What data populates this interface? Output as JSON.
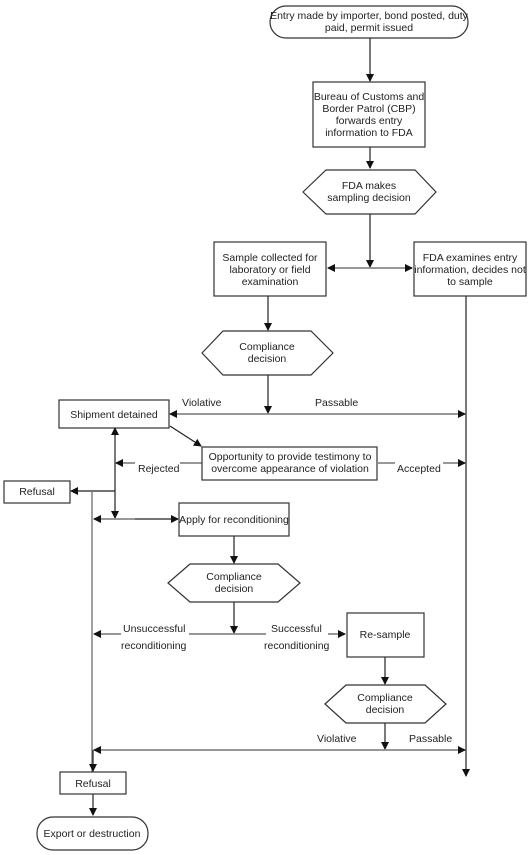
{
  "diagram": {
    "type": "flowchart",
    "nodes": {
      "entry": {
        "shape": "terminal",
        "lines": [
          "Entry made by importer, bond posted, duty",
          "paid, permit issued"
        ]
      },
      "cbp": {
        "shape": "process",
        "lines": [
          "Bureau of Customs and",
          "Border Patrol (CBP)",
          "forwards entry",
          "information to FDA"
        ]
      },
      "sampling_decision": {
        "shape": "decision",
        "lines": [
          "FDA makes",
          "sampling decision"
        ]
      },
      "sample_collected": {
        "shape": "process",
        "lines": [
          "Sample collected for",
          "laboratory or field",
          "examination"
        ]
      },
      "no_sample": {
        "shape": "process",
        "lines": [
          "FDA examines entry",
          "information, decides not",
          "to sample"
        ]
      },
      "compliance1": {
        "shape": "decision",
        "lines": [
          "Compliance",
          "decision"
        ]
      },
      "detained": {
        "shape": "process",
        "lines": [
          "Shipment detained"
        ]
      },
      "testimony": {
        "shape": "process",
        "lines": [
          "Opportunity to provide testimony to",
          "overcome appearance of violation"
        ]
      },
      "refusal1": {
        "shape": "process",
        "lines": [
          "Refusal"
        ]
      },
      "recondition": {
        "shape": "process",
        "lines": [
          "Apply for reconditioning"
        ]
      },
      "compliance2": {
        "shape": "decision",
        "lines": [
          "Compliance",
          "decision"
        ]
      },
      "resample": {
        "shape": "process",
        "lines": [
          "Re-sample"
        ]
      },
      "compliance3": {
        "shape": "decision",
        "lines": [
          "Compliance",
          "decision"
        ]
      },
      "refusal2": {
        "shape": "process",
        "lines": [
          "Refusal"
        ]
      },
      "export": {
        "shape": "terminal",
        "lines": [
          "Export or destruction"
        ]
      }
    },
    "edge_labels": {
      "violative1": "Violative",
      "passable1": "Passable",
      "rejected": "Rejected",
      "accepted": "Accepted",
      "unsuccessful": [
        "Unsuccessful",
        "reconditioning"
      ],
      "successful": [
        "Successful",
        "reconditioning"
      ],
      "violative2": "Violative",
      "passable2": "Passable"
    }
  }
}
